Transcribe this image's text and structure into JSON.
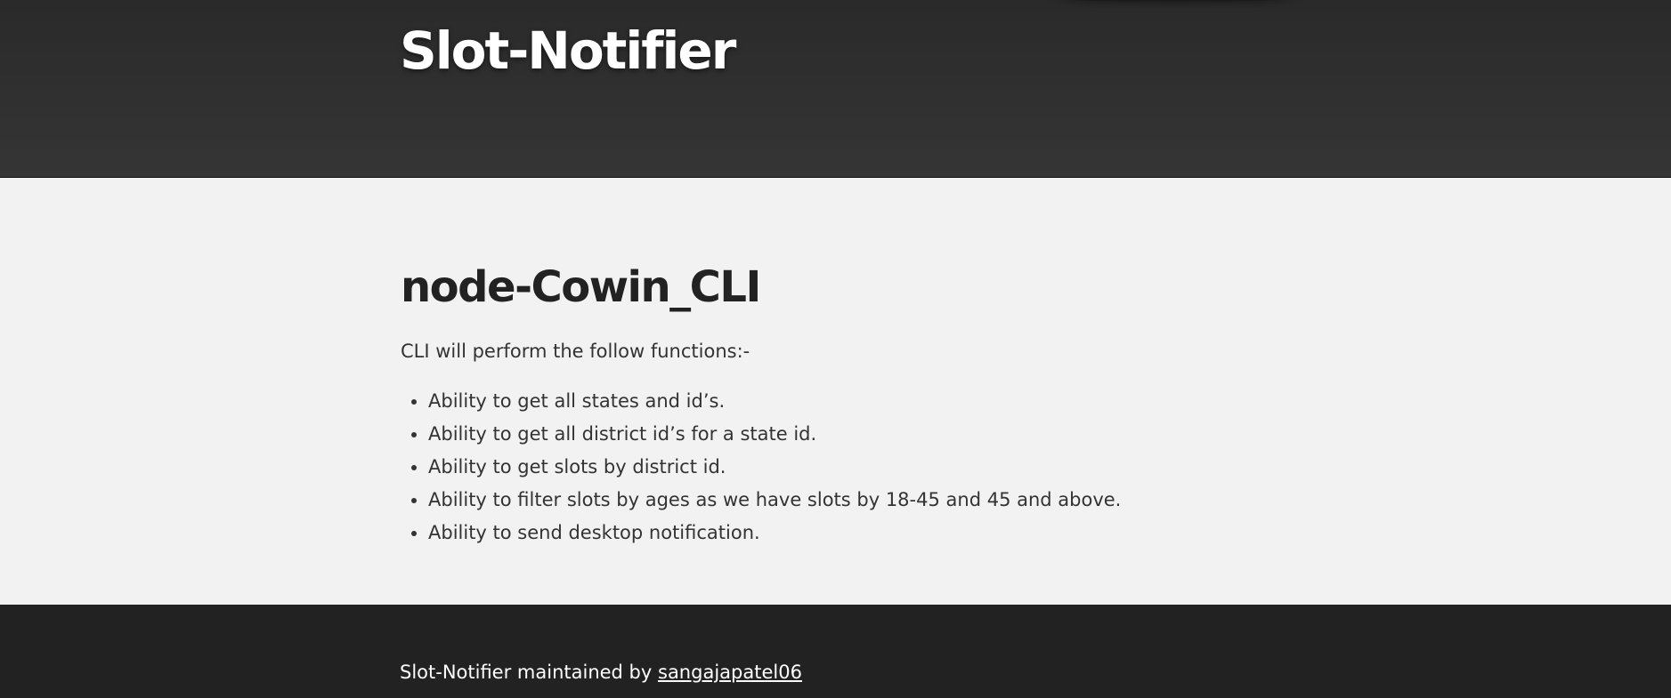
{
  "header": {
    "site_title": "Slot-Notifier"
  },
  "main": {
    "page_title": "node-Cowin_CLI",
    "intro": "CLI will perform the follow functions:-",
    "features": [
      "Ability to get all states and id’s.",
      "Ability to get all district id’s for a state id.",
      "Ability to get slots by district id.",
      "Ability to filter slots by ages as we have slots by 18-45 and 45 and above.",
      "Ability to send desktop notification."
    ]
  },
  "footer": {
    "text": "Slot-Notifier maintained by",
    "maintainer_link": "sangajapatel06"
  },
  "colors": {
    "header_bg": "#303030",
    "main_bg": "#f2f2f2",
    "footer_bg": "#222222",
    "text": "#222222",
    "header_text": "#ffffff"
  }
}
